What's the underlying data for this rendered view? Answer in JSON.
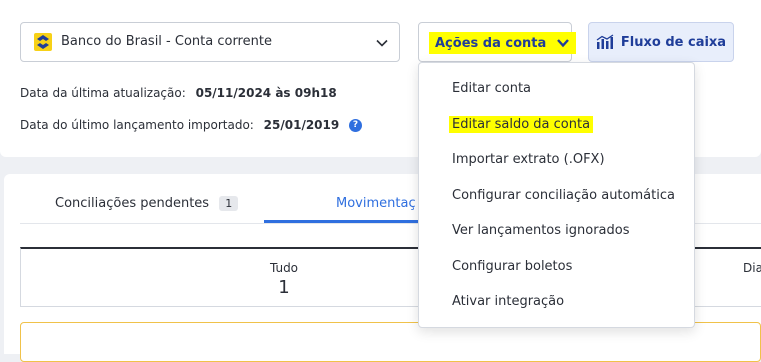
{
  "account": {
    "name": "Banco do Brasil - Conta corrente",
    "logo": "banco-do-brasil-logo"
  },
  "actions": {
    "label": "Ações da conta",
    "highlight_color": "#ffff00"
  },
  "fluxo": {
    "label": "Fluxo de caixa"
  },
  "info": {
    "last_update_label": "Data da última atualização:",
    "last_update_value": "05/11/2024 às 09h18",
    "last_import_label": "Data do último lançamento importado:",
    "last_import_value": "25/01/2019",
    "help_glyph": "?"
  },
  "tabs": [
    {
      "label": "Conciliações pendentes",
      "badge": "1"
    },
    {
      "label": "Movimentaç",
      "active": true
    }
  ],
  "summary": {
    "label": "Tudo",
    "value": "1",
    "right_label": "Dia"
  },
  "menu": {
    "items": [
      {
        "label": "Editar conta"
      },
      {
        "label": "Editar saldo da conta",
        "highlighted": true
      },
      {
        "label": "Importar extrato (.OFX)"
      },
      {
        "label": "Configurar conciliação automática"
      },
      {
        "label": "Ver lançamentos ignorados"
      },
      {
        "label": "Configurar boletos"
      },
      {
        "label": "Ativar integração"
      }
    ]
  },
  "colors": {
    "accent": "#2f6fdf",
    "brand_text": "#1f3d99",
    "bank_yellow": "#f7d117"
  }
}
